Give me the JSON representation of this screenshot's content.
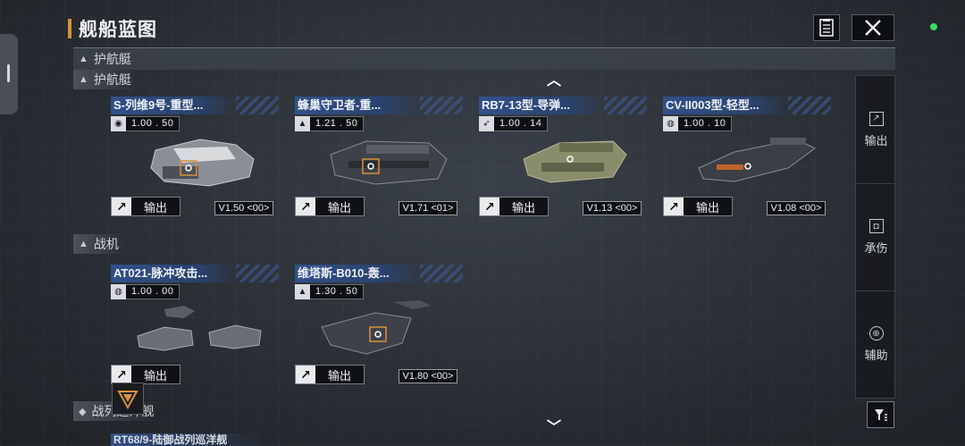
{
  "header": {
    "title": "舰船蓝图"
  },
  "sticky_category": {
    "icon": "corvette-icon",
    "label": "护航艇"
  },
  "categories": [
    {
      "label": "护航艇",
      "icon": "corvette-icon"
    },
    {
      "label": "战机",
      "icon": "fighter-icon"
    },
    {
      "label": "战列巡洋舰",
      "icon": "battlecruiser-icon"
    }
  ],
  "cards": [
    {
      "name": "S-列维9号-重型...",
      "ratio": "1.00 . 50",
      "ratio_icon": "missile-type-icon",
      "role": "输出",
      "version": "V1.50 <00>"
    },
    {
      "name": "蜂巢守卫者-重...",
      "ratio": "1.21 . 50",
      "ratio_icon": "tower-type-icon",
      "role": "输出",
      "version": "V1.71 <01>"
    },
    {
      "name": "RB7-13型-导弹...",
      "ratio": "1.00 . 14",
      "ratio_icon": "wing-type-icon",
      "role": "输出",
      "version": "V1.13 <00>"
    },
    {
      "name": "CV-II003型-轻型...",
      "ratio": "1.00 . 10",
      "ratio_icon": "globe-type-icon",
      "role": "输出",
      "version": "V1.08 <00>"
    },
    {
      "name": "AT021-脉冲攻击...",
      "ratio": "1.00 . 00",
      "ratio_icon": "globe-type-icon",
      "role": "输出",
      "version": ""
    },
    {
      "name": "维塔斯-B010-轰...",
      "ratio": "1.30 . 50",
      "ratio_icon": "tower-type-icon",
      "role": "输出",
      "version": "V1.80 <00>"
    }
  ],
  "partial_card": {
    "name": "RT68/9-陆御战列巡洋舰"
  },
  "filters": [
    {
      "label": "输出",
      "icon": "arrow-out-icon"
    },
    {
      "label": "承伤",
      "icon": "shield-icon"
    },
    {
      "label": "辅助",
      "icon": "support-icon"
    }
  ],
  "colors": {
    "accent": "#d8913a",
    "card_title": "#33508a",
    "status": "#3ddc5c"
  }
}
